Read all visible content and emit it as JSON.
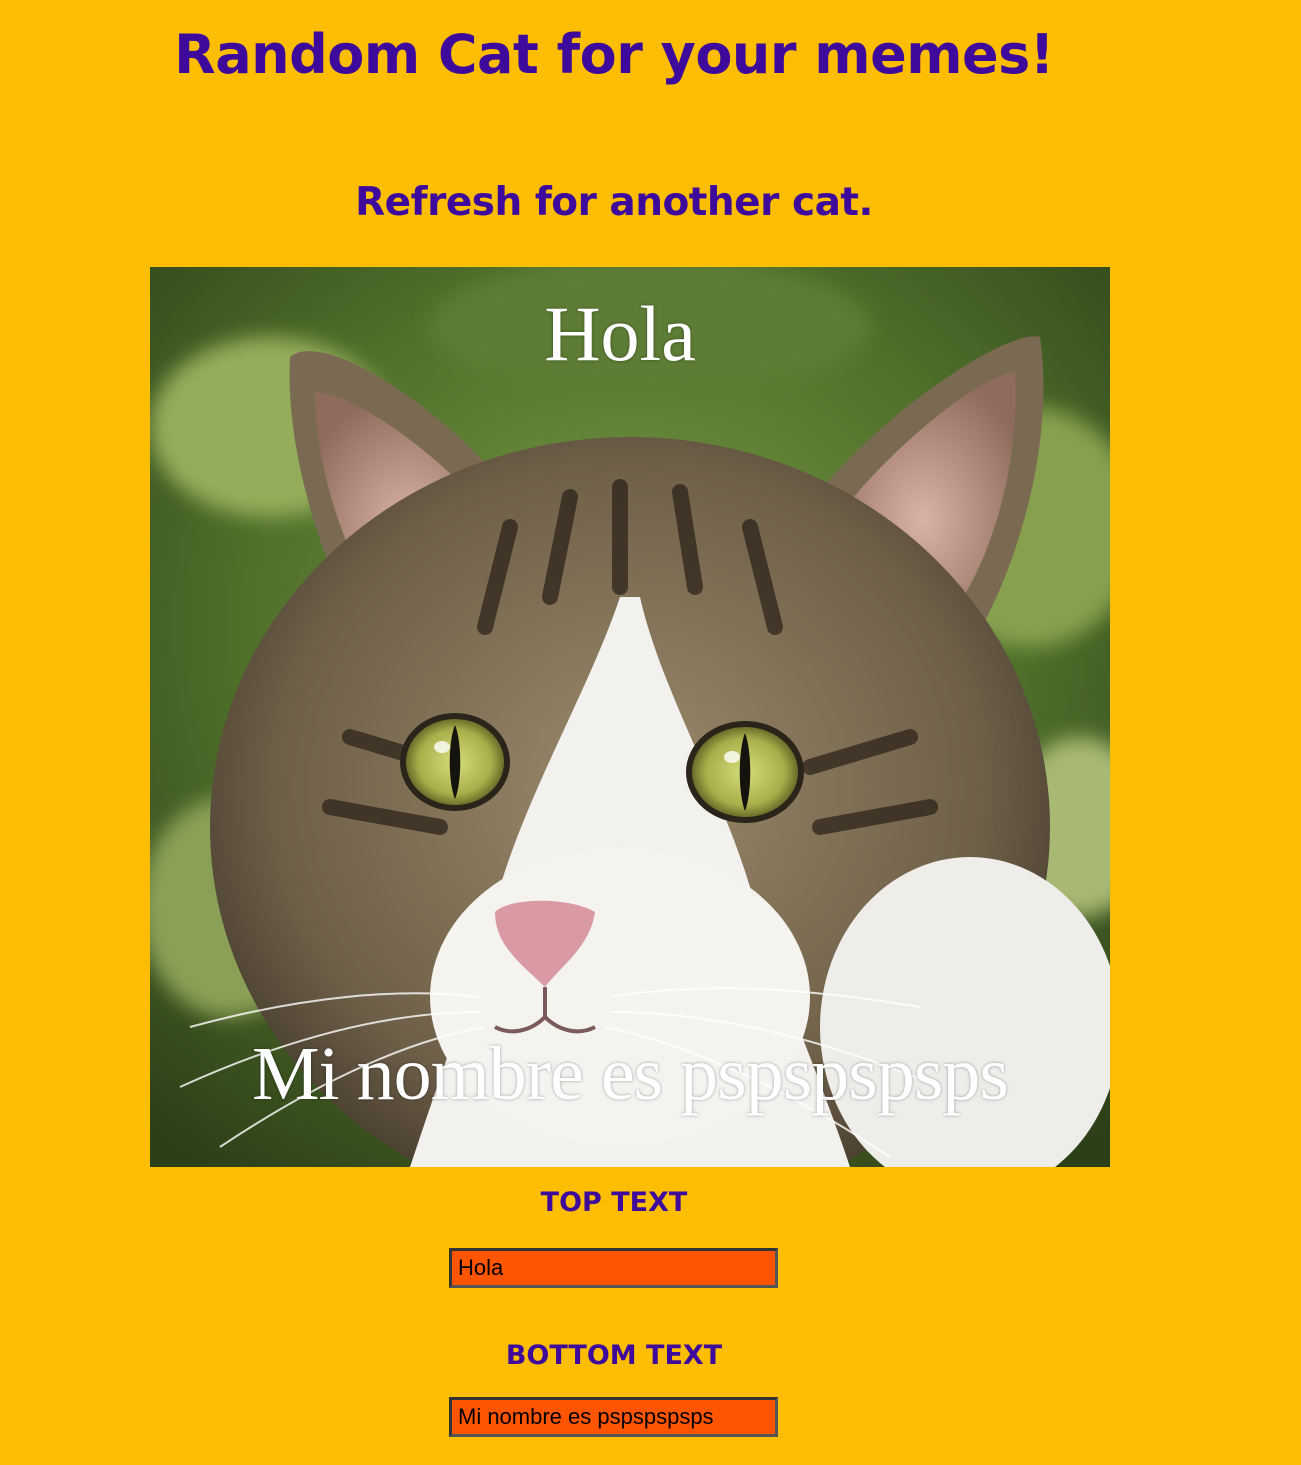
{
  "page": {
    "title": "Random Cat for your memes!",
    "subtitle": "Refresh for another cat."
  },
  "meme": {
    "top_text": "Hola",
    "bottom_text": "Mi nombre es pspspspsps",
    "image_subject": "tabby and white cat face photo"
  },
  "form": {
    "top_label": "TOP TEXT",
    "top_value": "Hola",
    "bottom_label": "BOTTOM TEXT",
    "bottom_value": "Mi nombre es pspspspsps"
  },
  "colors": {
    "background": "#FDBD00",
    "heading": "#3D0A9C",
    "input_background": "#FF5500"
  }
}
